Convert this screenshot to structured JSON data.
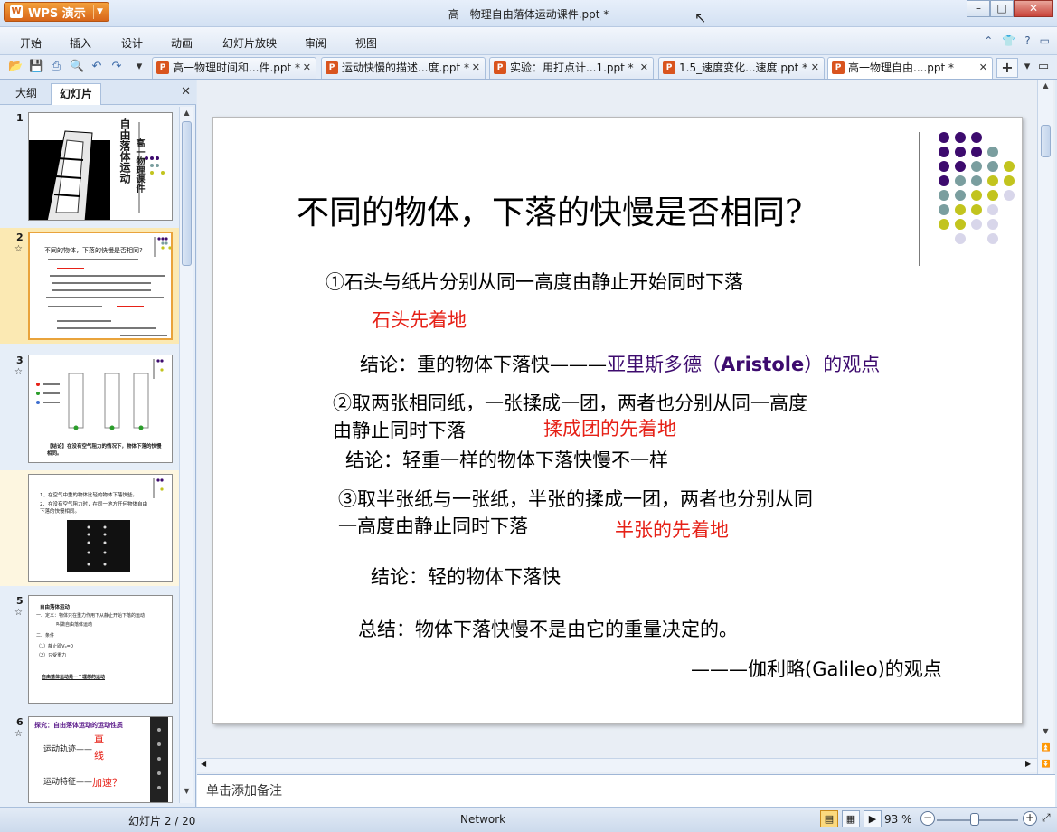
{
  "app": {
    "name": "WPS 演示",
    "window_title": "高一物理自由落体运动课件.ppt *"
  },
  "menu": [
    "开始",
    "插入",
    "设计",
    "动画",
    "幻灯片放映",
    "审阅",
    "视图"
  ],
  "doc_tabs": [
    {
      "label": "高一物理时间和...件.ppt *",
      "active": false
    },
    {
      "label": "运动快慢的描述...度.ppt *",
      "active": false
    },
    {
      "label": "实验：用打点计...1.ppt *",
      "active": false
    },
    {
      "label": "1.5_速度变化...速度.ppt *",
      "active": false
    },
    {
      "label": "高一物理自由....ppt *",
      "active": true
    }
  ],
  "left_panel": {
    "tabs": [
      "大纲",
      "幻灯片"
    ],
    "active_tab": "幻灯片",
    "thumbnails": [
      {
        "num": "1",
        "title": "自由落体运动",
        "subtitle": "高一物理课件"
      },
      {
        "num": "2",
        "title": "不同的物体，下落的快慢是否相同?"
      },
      {
        "num": "3",
        "caption": "【结论】在没有空气阻力的情况下，物体下落的快慢相同。"
      },
      {
        "num": "",
        "lines": [
          "1、在空气中重的物体比轻的物体下落快些。",
          "2、在没有空气阻力时，在同一地方任何物体自由下落的快慢相同。"
        ]
      },
      {
        "num": "5",
        "lines": [
          "自由落体运动",
          "一、定义：物体只在重力作用下从静止开始下落的运动",
          "叫做自由落体运动",
          "二、条件",
          "（1）静止即V₀=0",
          "（2）只受重力",
          "自由落体运动是一个理想的运动"
        ]
      },
      {
        "num": "6",
        "lines": [
          "探究：自由落体运动的运动性质",
          "运动轨迹——",
          "直",
          "线",
          "运动特征——",
          "加速？"
        ]
      }
    ]
  },
  "slide": {
    "title": "不同的物体，下落的快慢是否相同?",
    "item1": "①石头与纸片分别从同一高度由静止开始同时下落",
    "item1_result": "石头先着地",
    "conclusion1_prefix": "结论：重的物体下落快",
    "conclusion1_dash": "———",
    "conclusion1_view": "亚里斯多德（",
    "conclusion1_name": "Aristole",
    "conclusion1_suffix": "）的观点",
    "item2_line1": "②取两张相同纸，一张揉成一团，两者也分别从同一高度",
    "item2_line2": "由静止同时下落",
    "item2_result": "揉成团的先着地",
    "conclusion2": "结论：轻重一样的物体下落快慢不一样",
    "item3_line1": "③取半张纸与一张纸，半张的揉成一团，两者也分别从同",
    "item3_line2": "一高度由静止同时下落",
    "item3_result": "半张的先着地",
    "conclusion3": "结论：轻的物体下落快",
    "summary": "总结：物体下落快慢不是由它的重量决定的。",
    "galileo": "———伽利略(Galileo)的观点"
  },
  "colors": {
    "dot_purple": "#3d0b6e",
    "dot_teal": "#7a9e9f",
    "dot_yellow": "#c2c41e",
    "dot_lavender": "#d8d6ea",
    "accent_red": "#e62117"
  },
  "notes_placeholder": "单击添加备注",
  "status": {
    "slide_counter": "幻灯片 2 / 20",
    "network": "Network",
    "zoom": "93 %"
  }
}
